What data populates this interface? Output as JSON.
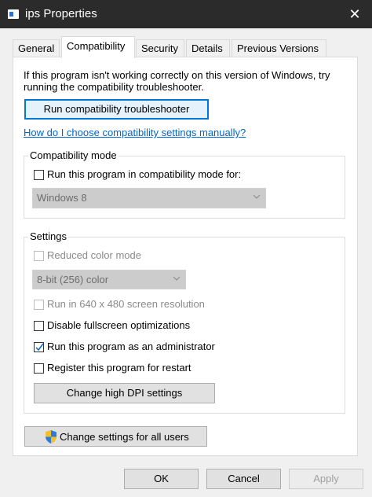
{
  "window": {
    "title": "ips Properties"
  },
  "tabs": [
    {
      "label": "General"
    },
    {
      "label": "Compatibility"
    },
    {
      "label": "Security"
    },
    {
      "label": "Details"
    },
    {
      "label": "Previous Versions"
    }
  ],
  "intro": {
    "line1": "If this program isn't working correctly on this version of Windows, try",
    "line2": "running the compatibility troubleshooter."
  },
  "troubleshooter_button": "Run compatibility troubleshooter",
  "help_link": "How do I choose compatibility settings manually?",
  "compat_mode": {
    "label": "Compatibility mode",
    "checkbox_label": "Run this program in compatibility mode for:",
    "checked": false,
    "os_selected": "Windows 8"
  },
  "settings": {
    "label": "Settings",
    "reduced_color": {
      "label": "Reduced color mode",
      "checked": false,
      "disabled": true
    },
    "color_depth": "8-bit (256) color",
    "res_640": {
      "label": "Run in 640 x 480 screen resolution",
      "checked": false,
      "disabled": true
    },
    "disable_fullscreen": {
      "label": "Disable fullscreen optimizations",
      "checked": false
    },
    "run_as_admin": {
      "label": "Run this program as an administrator",
      "checked": true
    },
    "register_restart": {
      "label": "Register this program for restart",
      "checked": false
    },
    "dpi_button": "Change high DPI settings"
  },
  "all_users_button": "Change settings for all users",
  "footer": {
    "ok": "OK",
    "cancel": "Cancel",
    "apply": "Apply"
  },
  "colors": {
    "titlebar": "#2b2b2b",
    "accent": "#0078d7",
    "link": "#0066cc"
  }
}
